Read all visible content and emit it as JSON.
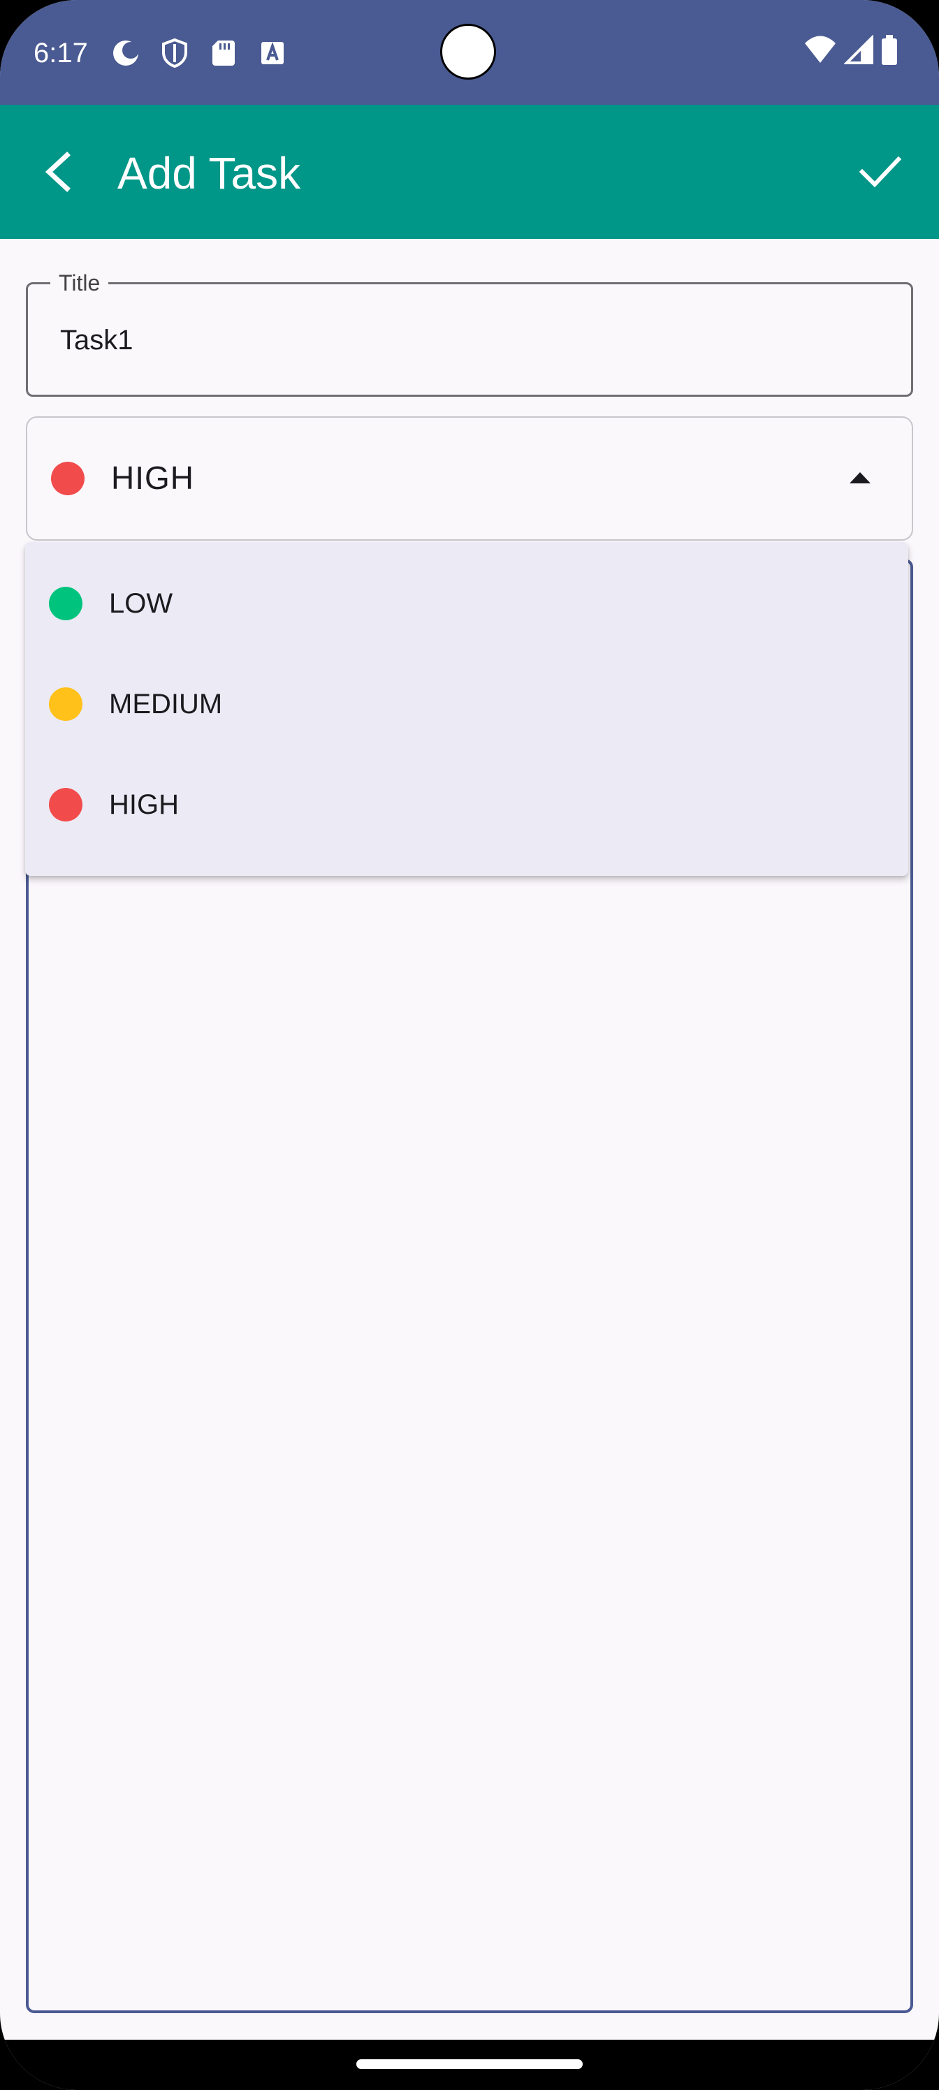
{
  "status_bar": {
    "time": "6:17",
    "icons_left": [
      "moon-icon",
      "shield-icon",
      "sd-card-icon",
      "font-a-icon"
    ],
    "icons_right": [
      "wifi-icon",
      "signal-icon",
      "battery-icon"
    ],
    "background": "#4a5a92"
  },
  "app_bar": {
    "title": "Add Task",
    "back_icon": "chevron-left-icon",
    "confirm_icon": "check-icon",
    "background": "#009688"
  },
  "form": {
    "title_field": {
      "label": "Title",
      "value": "Task1"
    },
    "priority_select": {
      "selected_label": "HIGH",
      "selected_color": "#f24b4b"
    },
    "description_field": {
      "value": ""
    }
  },
  "priority_menu": {
    "items": [
      {
        "label": "LOW",
        "color": "#00c47d"
      },
      {
        "label": "MEDIUM",
        "color": "#ffc11a"
      },
      {
        "label": "HIGH",
        "color": "#f24b4b"
      }
    ]
  },
  "colors": {
    "accent": "#009688",
    "status_bar": "#4a5a92",
    "surface": "#fbf8fc",
    "menu_surface": "#eceaf4"
  }
}
